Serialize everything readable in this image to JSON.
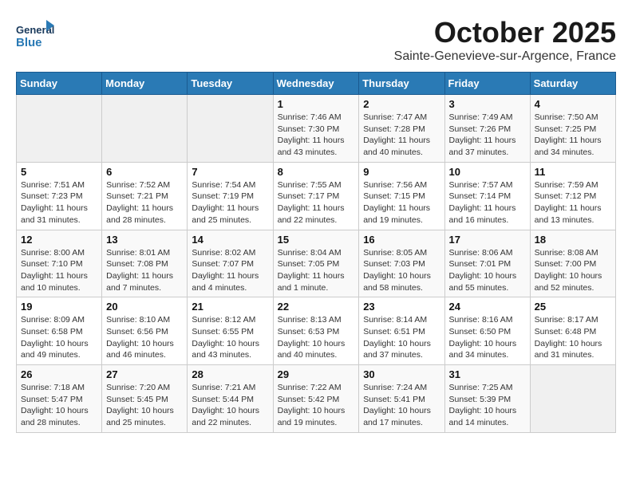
{
  "header": {
    "logo_line1": "General",
    "logo_line2": "Blue",
    "month": "October 2025",
    "location": "Sainte-Genevieve-sur-Argence, France"
  },
  "weekdays": [
    "Sunday",
    "Monday",
    "Tuesday",
    "Wednesday",
    "Thursday",
    "Friday",
    "Saturday"
  ],
  "weeks": [
    [
      {
        "day": "",
        "info": ""
      },
      {
        "day": "",
        "info": ""
      },
      {
        "day": "",
        "info": ""
      },
      {
        "day": "1",
        "info": "Sunrise: 7:46 AM\nSunset: 7:30 PM\nDaylight: 11 hours\nand 43 minutes."
      },
      {
        "day": "2",
        "info": "Sunrise: 7:47 AM\nSunset: 7:28 PM\nDaylight: 11 hours\nand 40 minutes."
      },
      {
        "day": "3",
        "info": "Sunrise: 7:49 AM\nSunset: 7:26 PM\nDaylight: 11 hours\nand 37 minutes."
      },
      {
        "day": "4",
        "info": "Sunrise: 7:50 AM\nSunset: 7:25 PM\nDaylight: 11 hours\nand 34 minutes."
      }
    ],
    [
      {
        "day": "5",
        "info": "Sunrise: 7:51 AM\nSunset: 7:23 PM\nDaylight: 11 hours\nand 31 minutes."
      },
      {
        "day": "6",
        "info": "Sunrise: 7:52 AM\nSunset: 7:21 PM\nDaylight: 11 hours\nand 28 minutes."
      },
      {
        "day": "7",
        "info": "Sunrise: 7:54 AM\nSunset: 7:19 PM\nDaylight: 11 hours\nand 25 minutes."
      },
      {
        "day": "8",
        "info": "Sunrise: 7:55 AM\nSunset: 7:17 PM\nDaylight: 11 hours\nand 22 minutes."
      },
      {
        "day": "9",
        "info": "Sunrise: 7:56 AM\nSunset: 7:15 PM\nDaylight: 11 hours\nand 19 minutes."
      },
      {
        "day": "10",
        "info": "Sunrise: 7:57 AM\nSunset: 7:14 PM\nDaylight: 11 hours\nand 16 minutes."
      },
      {
        "day": "11",
        "info": "Sunrise: 7:59 AM\nSunset: 7:12 PM\nDaylight: 11 hours\nand 13 minutes."
      }
    ],
    [
      {
        "day": "12",
        "info": "Sunrise: 8:00 AM\nSunset: 7:10 PM\nDaylight: 11 hours\nand 10 minutes."
      },
      {
        "day": "13",
        "info": "Sunrise: 8:01 AM\nSunset: 7:08 PM\nDaylight: 11 hours\nand 7 minutes."
      },
      {
        "day": "14",
        "info": "Sunrise: 8:02 AM\nSunset: 7:07 PM\nDaylight: 11 hours\nand 4 minutes."
      },
      {
        "day": "15",
        "info": "Sunrise: 8:04 AM\nSunset: 7:05 PM\nDaylight: 11 hours\nand 1 minute."
      },
      {
        "day": "16",
        "info": "Sunrise: 8:05 AM\nSunset: 7:03 PM\nDaylight: 10 hours\nand 58 minutes."
      },
      {
        "day": "17",
        "info": "Sunrise: 8:06 AM\nSunset: 7:01 PM\nDaylight: 10 hours\nand 55 minutes."
      },
      {
        "day": "18",
        "info": "Sunrise: 8:08 AM\nSunset: 7:00 PM\nDaylight: 10 hours\nand 52 minutes."
      }
    ],
    [
      {
        "day": "19",
        "info": "Sunrise: 8:09 AM\nSunset: 6:58 PM\nDaylight: 10 hours\nand 49 minutes."
      },
      {
        "day": "20",
        "info": "Sunrise: 8:10 AM\nSunset: 6:56 PM\nDaylight: 10 hours\nand 46 minutes."
      },
      {
        "day": "21",
        "info": "Sunrise: 8:12 AM\nSunset: 6:55 PM\nDaylight: 10 hours\nand 43 minutes."
      },
      {
        "day": "22",
        "info": "Sunrise: 8:13 AM\nSunset: 6:53 PM\nDaylight: 10 hours\nand 40 minutes."
      },
      {
        "day": "23",
        "info": "Sunrise: 8:14 AM\nSunset: 6:51 PM\nDaylight: 10 hours\nand 37 minutes."
      },
      {
        "day": "24",
        "info": "Sunrise: 8:16 AM\nSunset: 6:50 PM\nDaylight: 10 hours\nand 34 minutes."
      },
      {
        "day": "25",
        "info": "Sunrise: 8:17 AM\nSunset: 6:48 PM\nDaylight: 10 hours\nand 31 minutes."
      }
    ],
    [
      {
        "day": "26",
        "info": "Sunrise: 7:18 AM\nSunset: 5:47 PM\nDaylight: 10 hours\nand 28 minutes."
      },
      {
        "day": "27",
        "info": "Sunrise: 7:20 AM\nSunset: 5:45 PM\nDaylight: 10 hours\nand 25 minutes."
      },
      {
        "day": "28",
        "info": "Sunrise: 7:21 AM\nSunset: 5:44 PM\nDaylight: 10 hours\nand 22 minutes."
      },
      {
        "day": "29",
        "info": "Sunrise: 7:22 AM\nSunset: 5:42 PM\nDaylight: 10 hours\nand 19 minutes."
      },
      {
        "day": "30",
        "info": "Sunrise: 7:24 AM\nSunset: 5:41 PM\nDaylight: 10 hours\nand 17 minutes."
      },
      {
        "day": "31",
        "info": "Sunrise: 7:25 AM\nSunset: 5:39 PM\nDaylight: 10 hours\nand 14 minutes."
      },
      {
        "day": "",
        "info": ""
      }
    ]
  ]
}
